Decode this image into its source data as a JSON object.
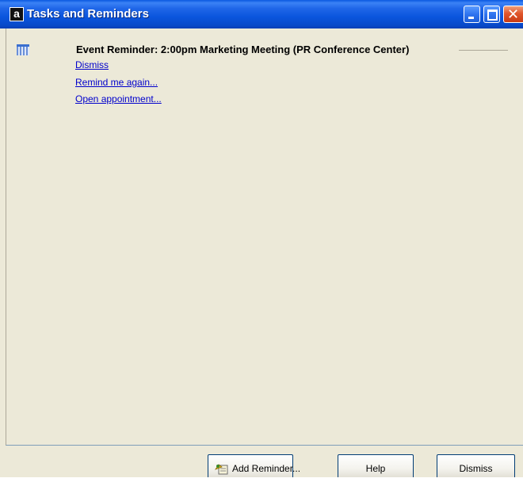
{
  "window": {
    "title": "Tasks and Reminders",
    "app_icon_letter": "a",
    "controls": {
      "minimize": "minimize",
      "maximize": "maximize",
      "close": "close"
    }
  },
  "reminder": {
    "icon": "calendar-icon",
    "title": "Event Reminder: 2:00pm Marketing Meeting (PR Conference Center)",
    "actions": {
      "dismiss": "Dismiss",
      "remind_again": "Remind me again...",
      "open_appointment": "Open appointment..."
    }
  },
  "footer": {
    "add_reminder_label": "Add Reminder...",
    "add_reminder_icon": "add-reminder-icon",
    "help_label": "Help",
    "dismiss_label": "Dismiss"
  },
  "colors": {
    "titlebar": "#0a55dd",
    "panel": "#ece9d8",
    "link": "#0000cc",
    "close_button": "#e0562c"
  }
}
